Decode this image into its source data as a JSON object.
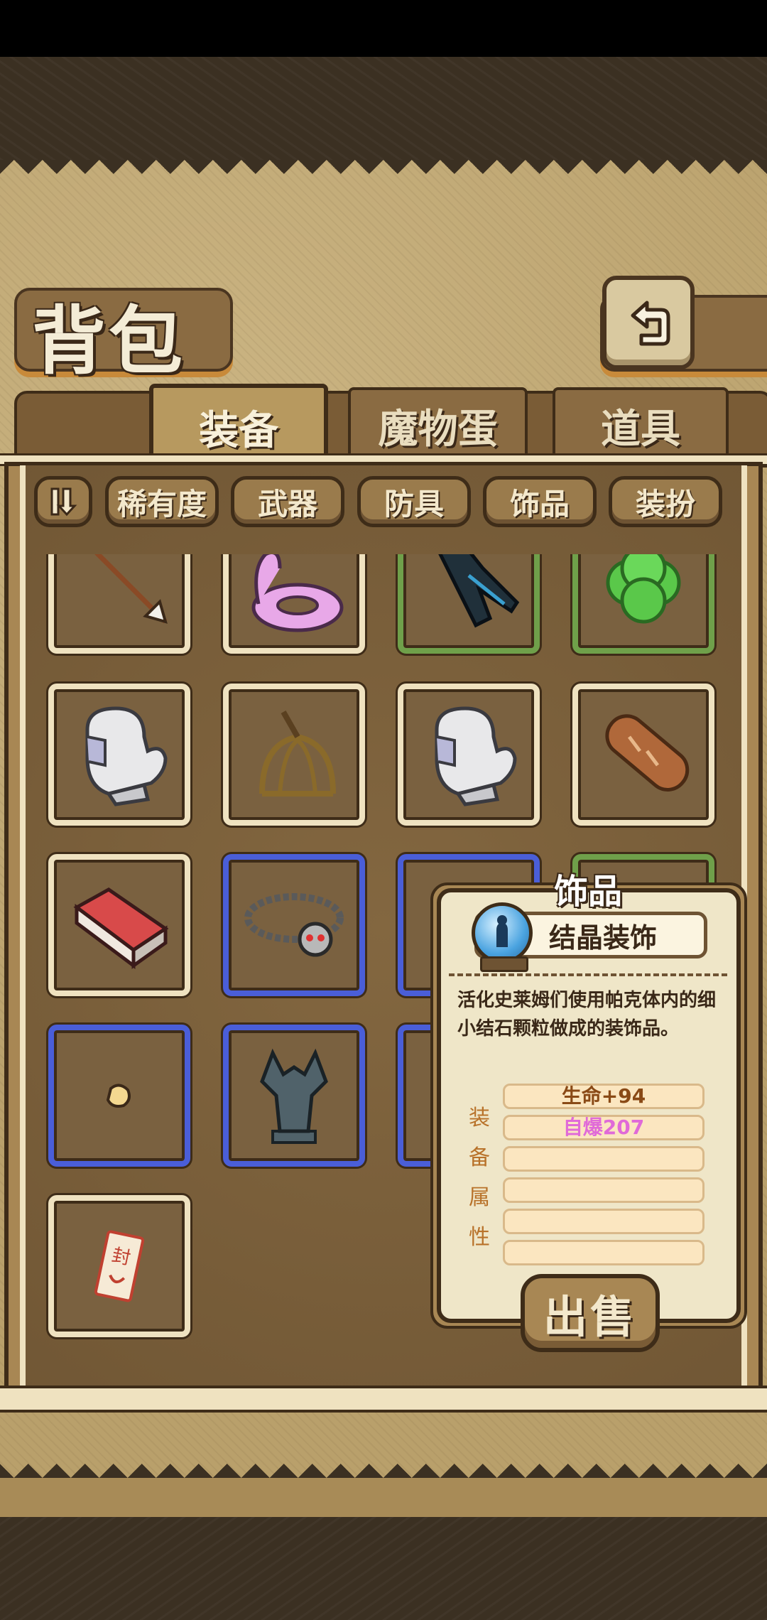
{
  "header": {
    "title": "背包"
  },
  "tabs": [
    {
      "label": "装备",
      "active": true
    },
    {
      "label": "魔物蛋",
      "active": false
    },
    {
      "label": "道具",
      "active": false
    }
  ],
  "filters": {
    "sort_icon": "sort-toggle-icon",
    "items": [
      "稀有度",
      "武器",
      "防具",
      "饰品",
      "装扮"
    ]
  },
  "inventory": {
    "items": [
      {
        "icon": "arrow-icon",
        "rarity": "common"
      },
      {
        "icon": "pink-swim-ring-icon",
        "rarity": "common"
      },
      {
        "icon": "dark-glove-icon",
        "rarity": "uncommon"
      },
      {
        "icon": "four-leaf-clover-icon",
        "rarity": "uncommon"
      },
      {
        "icon": "white-mitten-icon",
        "rarity": "common"
      },
      {
        "icon": "cage-helmet-icon",
        "rarity": "common"
      },
      {
        "icon": "white-mitten-icon",
        "rarity": "common"
      },
      {
        "icon": "bread-icon",
        "rarity": "common"
      },
      {
        "icon": "red-brick-icon",
        "rarity": "common"
      },
      {
        "icon": "skull-chain-necklace-icon",
        "rarity": "rare"
      },
      {
        "icon": "hidden-item-icon",
        "rarity": "rare"
      },
      {
        "icon": "hidden-item-icon",
        "rarity": "uncommon"
      },
      {
        "icon": "small-crystal-icon",
        "rarity": "rare"
      },
      {
        "icon": "gargoyle-statue-icon",
        "rarity": "rare"
      },
      {
        "icon": "hidden-item-icon",
        "rarity": "rare"
      },
      {
        "icon": "seal-talisman-icon",
        "rarity": "common"
      }
    ]
  },
  "detail": {
    "category": "饰品",
    "name": "结晶装饰",
    "icon": "crystal-globe-icon",
    "description": "活化史莱姆们使用帕克体内的细小结石颗粒做成的装饰品。",
    "attr_label": [
      "装",
      "备",
      "属",
      "性"
    ],
    "attributes": [
      {
        "text": "生命+94",
        "color": "#8a4a16"
      },
      {
        "text": "自爆207",
        "color": "#e06ad8"
      },
      {
        "text": "",
        "color": "#8a4a16"
      },
      {
        "text": "",
        "color": "#8a4a16"
      },
      {
        "text": "",
        "color": "#8a4a16"
      },
      {
        "text": "",
        "color": "#8a4a16"
      }
    ],
    "sell_label": "出售"
  },
  "colors": {
    "common_border": "#efe2c0",
    "uncommon_border": "#6fa04a",
    "rare_border": "#4a5ed8"
  }
}
